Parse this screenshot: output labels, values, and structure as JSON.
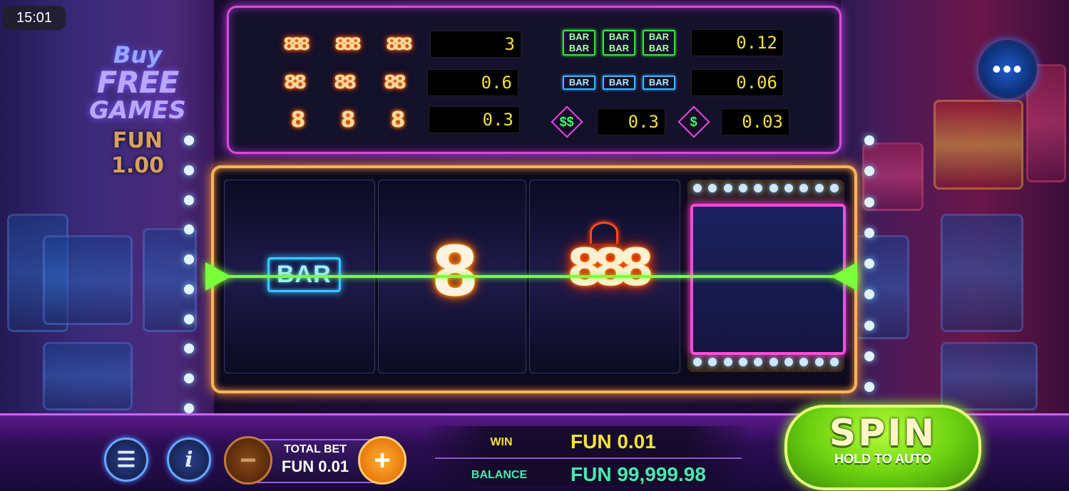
{
  "status_bar": {
    "time": "15:01"
  },
  "buy_feature": {
    "line1": "Buy",
    "line2": "FREE",
    "line3": "GAMES",
    "price": "FUN 1.00"
  },
  "menu_button": {
    "icon": "ellipsis-icon",
    "glyph": "•••"
  },
  "paytable": {
    "left": [
      {
        "symbols": [
          "888",
          "888",
          "888"
        ],
        "payout": "3"
      },
      {
        "symbols": [
          "88",
          "88",
          "88"
        ],
        "payout": "0.6"
      },
      {
        "symbols": [
          "8",
          "8",
          "8"
        ],
        "payout": "0.3"
      }
    ],
    "right": [
      {
        "symbols": [
          "BAR BAR",
          "BAR BAR",
          "BAR BAR"
        ],
        "payout": "0.12"
      },
      {
        "symbols": [
          "BAR",
          "BAR",
          "BAR"
        ],
        "payout": "0.06"
      }
    ],
    "dollar_row": [
      {
        "symbol": "$$",
        "payout": "0.3"
      },
      {
        "symbol": "$",
        "payout": "0.03"
      }
    ]
  },
  "reels": {
    "reel1": "BAR",
    "reel2": "8",
    "reel3": "888"
  },
  "bottom_bar": {
    "menu_icon": "☰",
    "info_icon": "i",
    "minus": "−",
    "plus": "+",
    "total_bet_label": "TOTAL BET",
    "total_bet_value": "FUN 0.01",
    "win_label": "WIN",
    "win_value": "FUN 0.01",
    "balance_label": "BALANCE",
    "balance_value": "FUN 99,999.98",
    "spin_label": "SPIN",
    "spin_sub": "HOLD TO AUTO"
  },
  "colors": {
    "win": "#f2e23a",
    "balance": "#4ae8b0",
    "payline": "#7aff3a",
    "spin": "#6ad010"
  }
}
